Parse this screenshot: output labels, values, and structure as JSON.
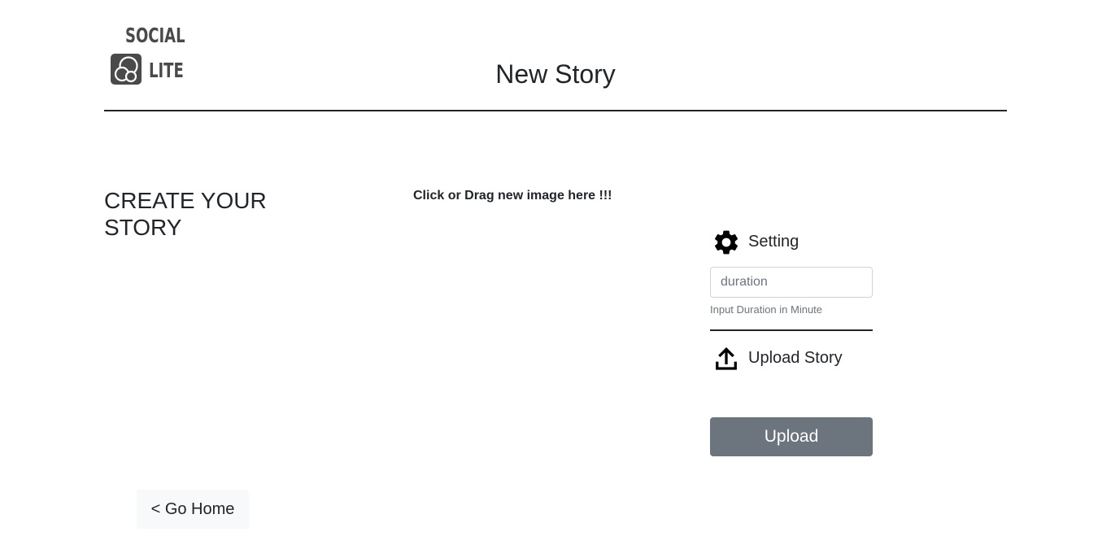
{
  "logo": {
    "top_text": "SOCIAL",
    "bottom_text": "LITE"
  },
  "header": {
    "title": "New Story"
  },
  "left": {
    "heading": "CREATE YOUR STORY",
    "go_home_label": "< Go Home"
  },
  "drop_zone": {
    "label": "Click or Drag new image here !!!"
  },
  "settings": {
    "title": "Setting",
    "icon": "gear-icon",
    "duration_placeholder": "duration",
    "duration_value": "",
    "duration_help": "Input Duration in Minute"
  },
  "upload": {
    "title": "Upload Story",
    "icon": "upload-icon",
    "button_label": "Upload"
  },
  "colors": {
    "text": "#212529",
    "upload_button": "#6c757d",
    "go_home_bg": "#f8f9fa",
    "muted": "#6c757d"
  }
}
